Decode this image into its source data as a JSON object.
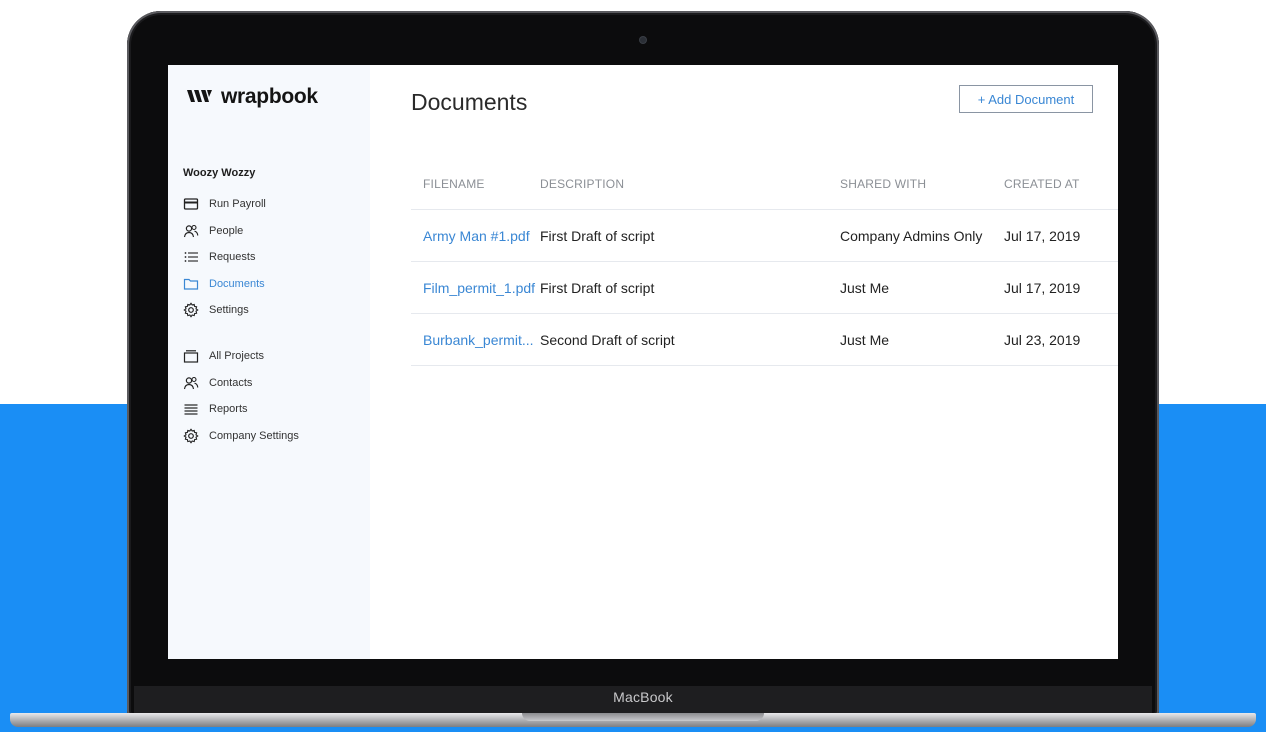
{
  "device": {
    "brand": "MacBook"
  },
  "app": {
    "logo_text": "wrapbook"
  },
  "sidebar": {
    "company": "Woozy Wozzy",
    "items": [
      {
        "label": "Run Payroll",
        "icon": "credit-card-icon"
      },
      {
        "label": "People",
        "icon": "people-icon"
      },
      {
        "label": "Requests",
        "icon": "list-icon"
      },
      {
        "label": "Documents",
        "icon": "folder-icon",
        "active": true
      },
      {
        "label": "Settings",
        "icon": "gear-icon"
      }
    ],
    "company_items": [
      {
        "label": "All Projects",
        "icon": "projects-icon"
      },
      {
        "label": "Contacts",
        "icon": "contacts-icon"
      },
      {
        "label": "Reports",
        "icon": "reports-icon"
      },
      {
        "label": "Company Settings",
        "icon": "gear-icon"
      }
    ]
  },
  "main": {
    "title": "Documents",
    "add_button": "+ Add Document",
    "table": {
      "headers": [
        "FILENAME",
        "DESCRIPTION",
        "SHARED WITH",
        "CREATED AT"
      ],
      "rows": [
        [
          "Army Man #1.pdf",
          "First Draft of script",
          "Company Admins Only",
          "Jul 17, 2019"
        ],
        [
          "Film_permit_1.pdf",
          "First Draft of script",
          "Just Me",
          "Jul 17, 2019"
        ],
        [
          "Burbank_permit...",
          "Second Draft of script",
          "Just Me",
          "Jul 23, 2019"
        ]
      ]
    }
  },
  "colors": {
    "accent": "#3a87d4",
    "background_blue": "#1a8ef5",
    "sidebar_bg": "#f6f9fd"
  }
}
